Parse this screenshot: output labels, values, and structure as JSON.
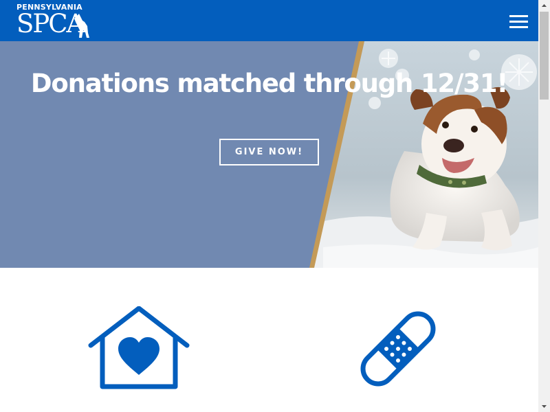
{
  "header": {
    "logo_top": "PENNSYLVANIA",
    "logo_main": "SPCA",
    "menu_icon": "hamburger-menu-icon"
  },
  "hero": {
    "title": "Donations matched through 12/31!",
    "button_label": "GIVE NOW!",
    "image_description_icon": "dog-in-snow-photo"
  },
  "features": {
    "icons": [
      "house-heart-icon",
      "bandage-icon"
    ]
  },
  "colors": {
    "brand_blue": "#035ebd",
    "hero_overlay": "#7189b1",
    "white": "#ffffff",
    "gold_stripe": "#c49a57"
  }
}
